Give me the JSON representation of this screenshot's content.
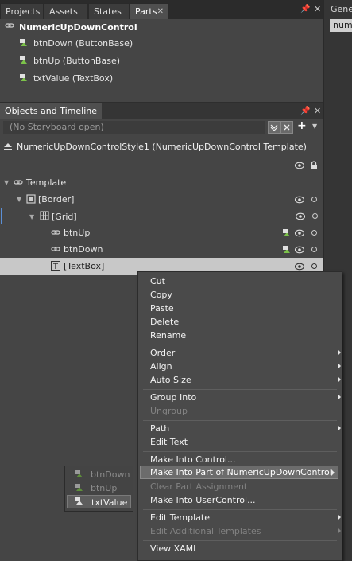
{
  "tabs": [
    "Projects",
    "Assets",
    "States",
    "Parts"
  ],
  "right_panel": {
    "label": "Gene",
    "chip": "num"
  },
  "parts": {
    "control": "NumericUpDownControl",
    "items": [
      "btnDown (ButtonBase)",
      "btnUp (ButtonBase)",
      "txtValue (TextBox)"
    ]
  },
  "objects": {
    "title": "Objects and Timeline",
    "storyboard": "(No Storyboard open)",
    "scope": "NumericUpDownControlStyle1 (NumericUpDownControl Template)",
    "tree": [
      "Template",
      "[Border]",
      "[Grid]",
      "btnUp",
      "btnDown",
      "[TextBox]"
    ]
  },
  "context_menu": {
    "groups": [
      [
        "Cut",
        "Copy",
        "Paste",
        "Delete",
        "Rename"
      ],
      [
        "Order",
        "Align",
        "Auto Size"
      ],
      [
        "Group Into",
        "Ungroup"
      ],
      [
        "Path",
        "Edit Text"
      ],
      [
        "Make Into Control...",
        "Make Into Part of NumericUpDownControl",
        "Clear Part Assignment",
        "Make Into UserControl..."
      ],
      [
        "Edit Template",
        "Edit Additional Templates"
      ],
      [
        "View XAML"
      ]
    ]
  },
  "submenu": {
    "items": [
      "btnDown",
      "btnUp",
      "txtValue"
    ]
  },
  "colors": {
    "bg": "#3a3a3a",
    "panel": "#454545",
    "selection": "#c8c8c8",
    "grid_outline": "#5b8fd6"
  }
}
